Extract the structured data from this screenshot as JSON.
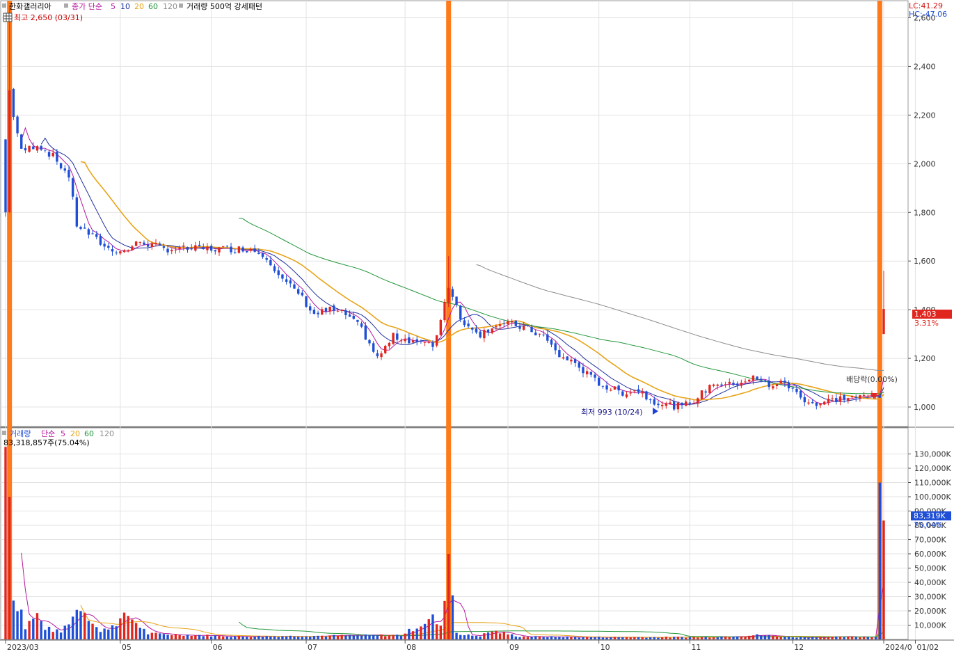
{
  "stock_name": "한화갤러리아",
  "price_panel": {
    "legend": {
      "close": "종가 단순",
      "ma_periods": [
        5,
        10,
        20,
        60,
        120
      ],
      "volume_pattern": "거래량 500억 강세패턴"
    },
    "high_label": "최고 2,650 (03/31)",
    "low_label": "최저 993 (10/24)",
    "lc": "LC:41.29",
    "hc": "HC:-47.06",
    "last_price": "1,403",
    "change_pct": "3.31%",
    "dividend_label": "배당락(0.00%)"
  },
  "volume_panel": {
    "legend_title": "거래량",
    "legend_simple": "단순",
    "ma_periods": [
      5,
      20,
      60,
      120
    ],
    "info": "83,318,857주(75.04%)",
    "last_value": "83,319K",
    "last_pct": "75.04%"
  },
  "x_labels": [
    {
      "label": "2023/03",
      "idx": 0
    },
    {
      "label": "05",
      "idx": 29
    },
    {
      "label": "06",
      "idx": 52
    },
    {
      "label": "07",
      "idx": 76
    },
    {
      "label": "08",
      "idx": 101
    },
    {
      "label": "09",
      "idx": 127
    },
    {
      "label": "10",
      "idx": 150
    },
    {
      "label": "11",
      "idx": 173
    },
    {
      "label": "12",
      "idx": 199
    },
    {
      "label": "2024/0",
      "idx": 222
    },
    {
      "label": "01/02",
      "idx": 230
    }
  ],
  "colors": {
    "up": "#e0261f",
    "down": "#1f4fd6",
    "ma5": "#b5179e",
    "ma10": "#1f2f9e",
    "ma20": "#e8a317",
    "ma60": "#23963a",
    "ma120": "#8c8c8c",
    "highlight": "#ff7a1a"
  },
  "chart_data": {
    "type": "candlestick",
    "y_price_ticks": [
      1000,
      1200,
      1400,
      1600,
      1800,
      2000,
      2200,
      2400,
      2600
    ],
    "y_price_range": [
      940,
      2650
    ],
    "y_volume_ticks": [
      10000,
      20000,
      30000,
      40000,
      50000,
      60000,
      70000,
      80000,
      90000,
      100000,
      110000,
      120000,
      130000
    ],
    "y_volume_range": [
      0,
      140000
    ],
    "highlight_days": [
      1,
      112,
      221
    ],
    "key_points": [
      {
        "date": "03/31",
        "high": 2650
      },
      {
        "date": "10/24",
        "low": 993
      },
      {
        "date": "last",
        "close": 1403,
        "volume_k": 83319
      }
    ],
    "anchors": [
      [
        0,
        1800
      ],
      [
        1,
        2300
      ],
      [
        2,
        2200
      ],
      [
        4,
        2050
      ],
      [
        8,
        2080
      ],
      [
        12,
        2030
      ],
      [
        16,
        1950
      ],
      [
        18,
        1750
      ],
      [
        22,
        1700
      ],
      [
        26,
        1650
      ],
      [
        30,
        1640
      ],
      [
        34,
        1680
      ],
      [
        40,
        1650
      ],
      [
        48,
        1650
      ],
      [
        56,
        1650
      ],
      [
        62,
        1650
      ],
      [
        66,
        1620
      ],
      [
        70,
        1520
      ],
      [
        74,
        1470
      ],
      [
        78,
        1380
      ],
      [
        82,
        1400
      ],
      [
        86,
        1380
      ],
      [
        90,
        1320
      ],
      [
        94,
        1200
      ],
      [
        98,
        1290
      ],
      [
        104,
        1270
      ],
      [
        108,
        1250
      ],
      [
        110,
        1360
      ],
      [
        112,
        1500
      ],
      [
        114,
        1420
      ],
      [
        116,
        1330
      ],
      [
        118,
        1330
      ],
      [
        120,
        1300
      ],
      [
        124,
        1340
      ],
      [
        128,
        1340
      ],
      [
        132,
        1320
      ],
      [
        136,
        1290
      ],
      [
        140,
        1210
      ],
      [
        144,
        1180
      ],
      [
        148,
        1120
      ],
      [
        152,
        1080
      ],
      [
        156,
        1060
      ],
      [
        160,
        1070
      ],
      [
        163,
        1030
      ],
      [
        167,
        1010
      ],
      [
        171,
        1000
      ],
      [
        175,
        1040
      ],
      [
        179,
        1100
      ],
      [
        183,
        1090
      ],
      [
        187,
        1110
      ],
      [
        189,
        1120
      ],
      [
        193,
        1090
      ],
      [
        197,
        1100
      ],
      [
        201,
        1040
      ],
      [
        205,
        1010
      ],
      [
        209,
        1030
      ],
      [
        213,
        1040
      ],
      [
        217,
        1040
      ],
      [
        220,
        1050
      ],
      [
        221,
        1050
      ],
      [
        222,
        1403
      ]
    ],
    "volume_anchors_k": [
      [
        0,
        135000
      ],
      [
        1,
        100000
      ],
      [
        2,
        28000
      ],
      [
        3,
        25000
      ],
      [
        4,
        20000
      ],
      [
        5,
        8000
      ],
      [
        6,
        12000
      ],
      [
        8,
        17000
      ],
      [
        10,
        8000
      ],
      [
        14,
        5000
      ],
      [
        19,
        24000
      ],
      [
        24,
        5000
      ],
      [
        31,
        17000
      ],
      [
        36,
        4000
      ],
      [
        60,
        2000
      ],
      [
        100,
        3000
      ],
      [
        108,
        15000
      ],
      [
        110,
        8000
      ],
      [
        112,
        60000
      ],
      [
        114,
        5000
      ],
      [
        116,
        3000
      ],
      [
        120,
        2500
      ],
      [
        123,
        6000
      ],
      [
        130,
        2000
      ],
      [
        150,
        1500
      ],
      [
        177,
        1500
      ],
      [
        190,
        3000
      ],
      [
        200,
        1500
      ],
      [
        220,
        1800
      ],
      [
        221,
        110000
      ],
      [
        222,
        83319
      ]
    ]
  }
}
